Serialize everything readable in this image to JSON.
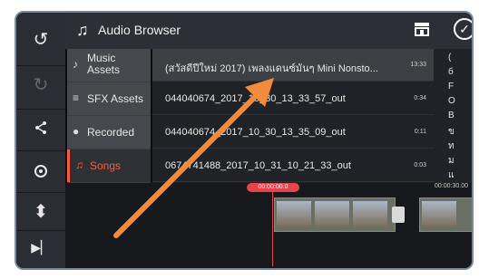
{
  "header": {
    "title": "Audio Browser"
  },
  "categories": [
    {
      "label": "Music Assets",
      "icon": "music-assets-icon"
    },
    {
      "label": "SFX Assets",
      "icon": "sfx-icon"
    },
    {
      "label": "Recorded",
      "icon": "mic-icon"
    },
    {
      "label": "Songs",
      "icon": "music-note-icon",
      "active": true
    }
  ],
  "songs": [
    {
      "name": "(สวัสดีปีใหม่ 2017) เพลงแดนซ์มันๆ Mini Nonsto...",
      "duration": "13:33"
    },
    {
      "name": "044040674_2017_10_30_13_33_57_out",
      "duration": "0:34"
    },
    {
      "name": "044040674_2017_10_30_13_35_09_out",
      "duration": "0:11"
    },
    {
      "name": "0674741488_2017_10_31_10_21_33_out",
      "duration": "0:03"
    }
  ],
  "index_letters": [
    "(",
    "б",
    "F",
    "O",
    "B",
    "ข",
    "ท",
    "ม",
    "แ"
  ],
  "timeline": {
    "current_time": "00:00:00.0",
    "end_time": "00:00:30.00"
  },
  "colors": {
    "accent": "#ff5a3c",
    "playhead": "#e8434a",
    "arrow": "#f28c3c"
  }
}
